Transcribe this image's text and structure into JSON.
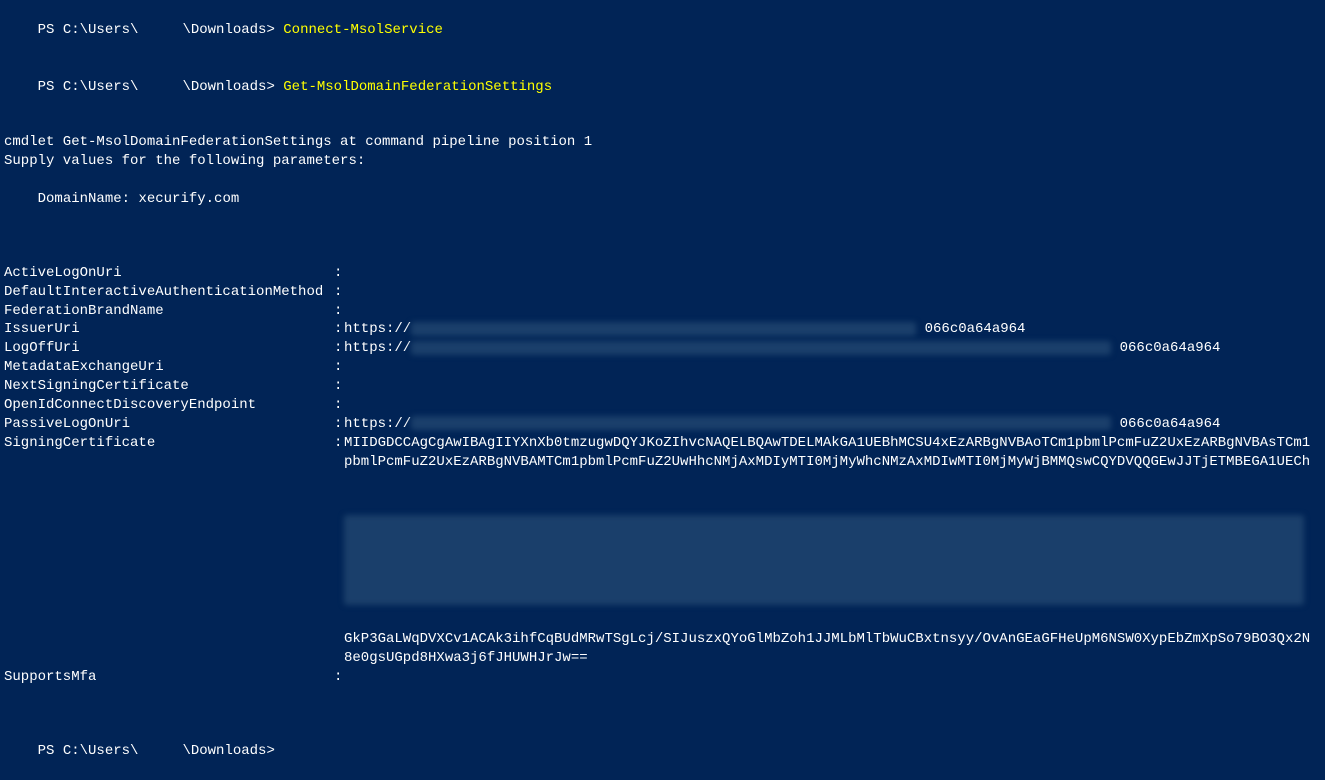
{
  "prompt_prefix": "PS C:\\Users\\",
  "prompt_suffix": "\\Downloads>",
  "redacted_user": "     ",
  "commands": {
    "cmd1": "Connect-MsolService",
    "cmd2": "Get-MsolDomainFederationSettings"
  },
  "cmdlet_prompt_line1": "cmdlet Get-MsolDomainFederationSettings at command pipeline position 1",
  "cmdlet_prompt_line2": "Supply values for the following parameters:",
  "domain_name_label": "DomainName:",
  "domain_name_value": "xecurify.com",
  "separator": ":",
  "properties": {
    "ActiveLogOnUri": {
      "label": "ActiveLogOnUri",
      "value": ""
    },
    "DefaultInteractiveAuthenticationMethod": {
      "label": "DefaultInteractiveAuthenticationMethod",
      "value": ""
    },
    "FederationBrandName": {
      "label": "FederationBrandName",
      "value": ""
    },
    "IssuerUri": {
      "label": "IssuerUri",
      "prefix": "https://",
      "visible_suffix": "066c0a64a964"
    },
    "LogOffUri": {
      "label": "LogOffUri",
      "prefix": "https://",
      "visible_suffix": "066c0a64a964"
    },
    "MetadataExchangeUri": {
      "label": "MetadataExchangeUri",
      "value": ""
    },
    "NextSigningCertificate": {
      "label": "NextSigningCertificate",
      "value": ""
    },
    "OpenIdConnectDiscoveryEndpoint": {
      "label": "OpenIdConnectDiscoveryEndpoint",
      "value": ""
    },
    "PassiveLogOnUri": {
      "label": "PassiveLogOnUri",
      "prefix": "https://",
      "visible_suffix": "066c0a64a964"
    },
    "SigningCertificate": {
      "label": "SigningCertificate",
      "line1": "MIIDGDCCAgCgAwIBAgIIYXnXb0tmzugwDQYJKoZIhvcNAQELBQAwTDELMAkGA1UEBhMCSU4xEzARBgNVBAoTCm1pbmlPcmFuZ2UxEzARBgNVBAsTCm1",
      "line2": "pbmlPcmFuZ2UxEzARBgNVBAMTCm1pbmlPcmFuZ2UwHhcNMjAxMDIyMTI0MjMyWhcNMzAxMDIwMTI0MjMyWjBMMQswCQYDVQQGEwJJTjETMBEGA1UECh",
      "line3": "GkP3GaLWqDVXCv1ACAk3ihfCqBUdMRwTSgLcj/SIJuszxQYoGlMbZoh1JJMLbMlTbWuCBxtnsyy/OvAnGEaGFHeUpM6NSW0XypEbZmXpSo79BO3Qx2N",
      "line4": "8e0gsUGpd8HXwa3j6fJHUWHJrJw=="
    },
    "SupportsMfa": {
      "label": "SupportsMfa",
      "value": ""
    }
  }
}
